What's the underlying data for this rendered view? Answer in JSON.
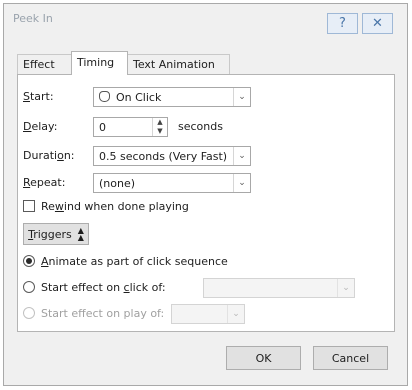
{
  "window": {
    "title": "Peek In",
    "help_label": "?",
    "close_label": "✕"
  },
  "tabs": [
    {
      "label": "Effect"
    },
    {
      "label": "Timing"
    },
    {
      "label": "Text Animation"
    }
  ],
  "timing": {
    "start": {
      "label_pre": "",
      "label_key": "S",
      "label_post": "tart:",
      "value": "On Click",
      "icon": "mouse-click-icon"
    },
    "delay": {
      "label_key": "D",
      "label_post": "elay:",
      "value": "0",
      "unit": "seconds"
    },
    "duration": {
      "label_pre": "Durati",
      "label_key": "o",
      "label_post": "n:",
      "value": "0.5 seconds (Very Fast)"
    },
    "repeat": {
      "label_key": "R",
      "label_post": "epeat:",
      "value": "(none)"
    },
    "rewind": {
      "label_pre": "Re",
      "label_key": "w",
      "label_post": "ind when done playing",
      "checked": false
    },
    "triggers": {
      "label_key": "T",
      "label_post": "riggers",
      "icon": "collapse-arrow-icon"
    },
    "animate_seq": {
      "label_key": "A",
      "label_post": "nimate as part of click sequence",
      "selected": true
    },
    "start_click": {
      "label_pre": "Start effect on ",
      "label_key": "c",
      "label_post": "lick of:",
      "selected": false,
      "value": ""
    },
    "start_play": {
      "label": "Start effect on play of:",
      "enabled": false,
      "value": ""
    }
  },
  "buttons": {
    "ok": "OK",
    "cancel": "Cancel"
  }
}
